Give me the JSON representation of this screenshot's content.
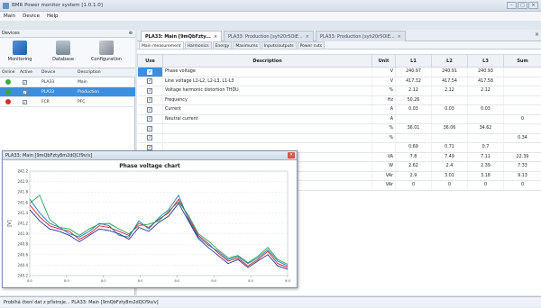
{
  "window": {
    "title": "BMR Power monitor system [1.0.1.0]"
  },
  "menu": [
    "Main",
    "Device",
    "Help"
  ],
  "devices": {
    "header": "Devices",
    "pin": "⊕",
    "toolbar": [
      {
        "label": "Monitoring",
        "icon": "monitoring-icon",
        "color": "#3a7bc8"
      },
      {
        "label": "Database",
        "icon": "database-icon",
        "color": "#7a8a9a"
      },
      {
        "label": "Configuration",
        "icon": "configuration-icon",
        "color": "#8a8f96"
      }
    ],
    "columns": [
      "Online",
      "Active",
      "Device",
      "Description"
    ],
    "rows": [
      {
        "online": "#3aaa35",
        "device": "PLA33",
        "description": "Main",
        "selected": false
      },
      {
        "online": "#3aaa35",
        "device": "PLA33",
        "description": "Production",
        "selected": true
      },
      {
        "online": "#d62b2b",
        "device": "FCR",
        "description": "PFC",
        "selected": false
      }
    ]
  },
  "tabs": [
    {
      "label": "PLA33: Main [9mQbFzty...",
      "active": true
    },
    {
      "label": "PLA33: Production [syh20r5OiE...",
      "active": false
    },
    {
      "label": "PLA33: Production [syh20r5OiE...",
      "active": false
    }
  ],
  "subtabs": [
    "Main measurement",
    "Harmonics",
    "Energy",
    "Maximums",
    "Inputs/outputs",
    "Power cuts"
  ],
  "table": {
    "headers": [
      "Use",
      "Description",
      "Unit",
      "L1",
      "L2",
      "L3",
      "Sum"
    ],
    "rows": [
      {
        "desc": "Phase voltage",
        "unit": "V",
        "l1": "240.97",
        "l2": "240.91",
        "l3": "240.93",
        "sum": "",
        "group": false,
        "hl": true
      },
      {
        "desc": "Line voltage L1-L2, L2-L3, L1-L3",
        "unit": "V",
        "l1": "417.32",
        "l2": "417.54",
        "l3": "417.58",
        "sum": "",
        "group": false,
        "hl": false
      },
      {
        "desc": "Voltage harmonic distortion THDU",
        "unit": "%",
        "l1": "2.12",
        "l2": "2.12",
        "l3": "2.12",
        "sum": "",
        "group": false,
        "hl": false
      },
      {
        "desc": "Frequency",
        "unit": "Hz",
        "l1": "50.26",
        "l2": "",
        "l3": "",
        "sum": "",
        "group": false,
        "hl": false
      },
      {
        "desc": "Current",
        "unit": "A",
        "l1": "0.03",
        "l2": "0.03",
        "l3": "0.03",
        "sum": "",
        "group": true,
        "hl": false
      },
      {
        "desc": "Neutral current",
        "unit": "A",
        "l1": "",
        "l2": "",
        "l3": "",
        "sum": "0",
        "group": false,
        "hl": false
      },
      {
        "desc": "",
        "unit": "%",
        "l1": "36.01",
        "l2": "36.06",
        "l3": "34.62",
        "sum": "",
        "group": false,
        "hl": false
      },
      {
        "desc": "",
        "unit": "%",
        "l1": "",
        "l2": "",
        "l3": "",
        "sum": "0.34",
        "group": false,
        "hl": false
      },
      {
        "desc": "",
        "unit": "",
        "l1": "0.69",
        "l2": "0.71",
        "l3": "0.7",
        "sum": "",
        "group": true,
        "hl": false
      },
      {
        "desc": "",
        "unit": "VA",
        "l1": "7.8",
        "l2": "7.49",
        "l3": "7.11",
        "sum": "22.39",
        "group": false,
        "hl": false
      },
      {
        "desc": "",
        "unit": "W",
        "l1": "2.62",
        "l2": "2.4",
        "l3": "2.39",
        "sum": "7.33",
        "group": false,
        "hl": false
      },
      {
        "desc": "",
        "unit": "VAr",
        "l1": "2.9",
        "l2": "3.01",
        "l3": "3.18",
        "sum": "9.13",
        "group": false,
        "hl": false
      },
      {
        "desc": "",
        "unit": "VAr",
        "l1": "0",
        "l2": "0",
        "l3": "0",
        "sum": "0",
        "group": false,
        "hl": false
      }
    ]
  },
  "chart_window": {
    "title": "PLA33: Main [9mQbFzty8m2dQCf9v/v]"
  },
  "chart_data": {
    "type": "line",
    "title": "Phase voltage chart",
    "ylabel": "[V]",
    "ylim": [
      240.9,
      242.2
    ],
    "yticks": [
      "242.2",
      "242.0",
      "241.8",
      "241.6",
      "241.4",
      "241.2",
      "241.0",
      "240.8",
      "240.6",
      "240.4",
      "240.2"
    ],
    "x": [
      0,
      1,
      2,
      3,
      4,
      5,
      6,
      7,
      8,
      9,
      10,
      11,
      12,
      13,
      14,
      15,
      16,
      17,
      18,
      19,
      20,
      21,
      22,
      23,
      24,
      25,
      26
    ],
    "series": [
      {
        "color": "#d02020",
        "values": [
          241.78,
          241.63,
          241.52,
          241.48,
          241.45,
          241.35,
          241.42,
          241.52,
          241.5,
          241.45,
          241.4,
          241.55,
          241.5,
          241.6,
          241.68,
          241.85,
          241.62,
          241.4,
          241.3,
          241.18,
          241.08,
          241.12,
          241.02,
          241.1,
          241.2,
          241.05,
          241.0
        ]
      },
      {
        "color": "#1a7ab8",
        "values": [
          241.85,
          241.68,
          241.55,
          241.5,
          241.42,
          241.38,
          241.45,
          241.55,
          241.52,
          241.4,
          241.38,
          241.58,
          241.48,
          241.62,
          241.72,
          241.9,
          241.6,
          241.38,
          241.28,
          241.2,
          241.1,
          241.14,
          241.05,
          241.12,
          241.22,
          241.08,
          241.02
        ]
      },
      {
        "color": "#2a2f8a",
        "values": [
          241.72,
          241.58,
          241.48,
          241.45,
          241.4,
          241.32,
          241.4,
          241.48,
          241.46,
          241.42,
          241.35,
          241.5,
          241.45,
          241.56,
          241.64,
          241.8,
          241.58,
          241.36,
          241.25,
          241.15,
          241.05,
          241.1,
          241.0,
          241.08,
          241.16,
          241.02,
          240.98
        ]
      },
      {
        "color": "#20a050",
        "values": [
          241.8,
          241.9,
          241.6,
          241.5,
          241.48,
          241.4,
          241.48,
          241.54,
          241.55,
          241.48,
          241.42,
          241.52,
          241.54,
          241.58,
          241.7,
          241.82,
          241.65,
          241.42,
          241.33,
          241.22,
          241.12,
          241.15,
          241.06,
          241.14,
          241.25,
          241.1,
          241.04
        ]
      }
    ],
    "xticks": [
      "8:0",
      "8:0",
      "8:0",
      "8:0",
      "8:0",
      "8:0",
      "8:0",
      "8:0"
    ]
  },
  "status": "Probíhá čtení dat z přístroje... PLA33: Main [9mQbFzty8m2dQCf9v/v]"
}
